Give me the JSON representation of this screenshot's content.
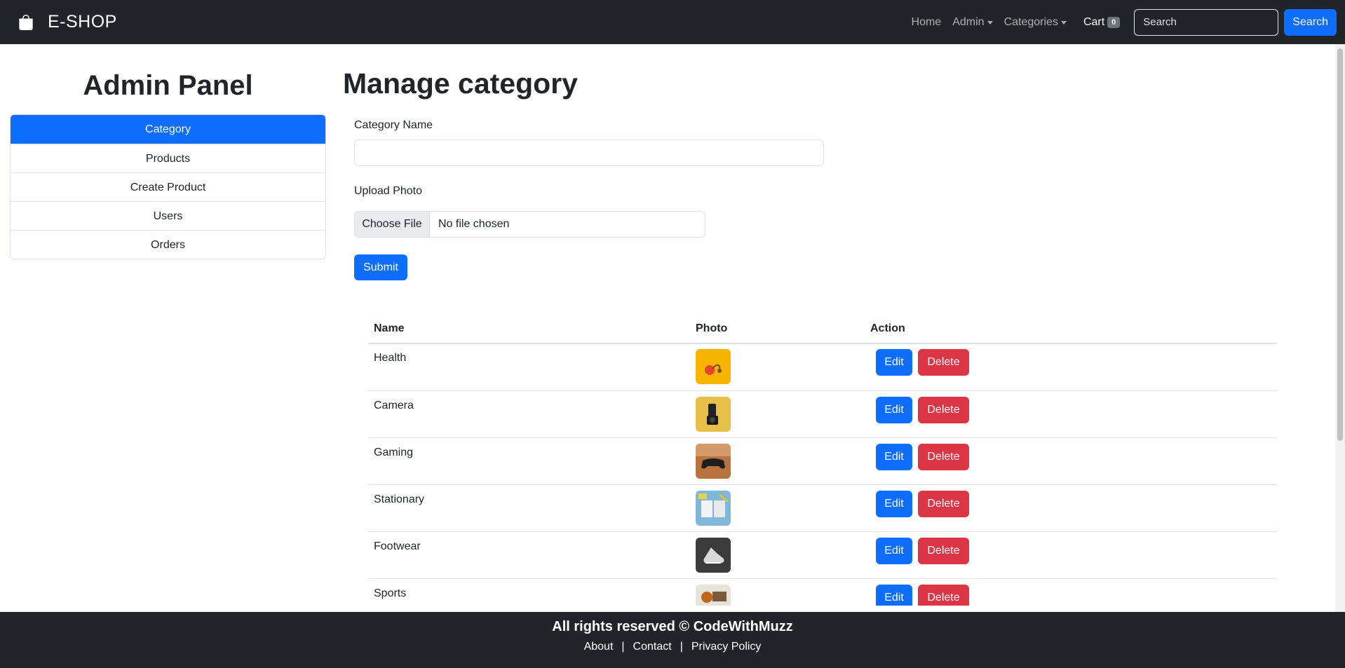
{
  "navbar": {
    "brand": "E-SHOP",
    "links": {
      "home": "Home",
      "admin": "Admin",
      "categories": "Categories"
    },
    "cart_label": "Cart",
    "cart_count": "0",
    "search_placeholder": "Search",
    "search_button": "Search"
  },
  "sidebar": {
    "title": "Admin Panel",
    "items": [
      {
        "label": "Category",
        "active": true
      },
      {
        "label": "Products"
      },
      {
        "label": "Create Product"
      },
      {
        "label": "Users"
      },
      {
        "label": "Orders"
      }
    ]
  },
  "main": {
    "title": "Manage category",
    "form": {
      "name_label": "Category Name",
      "name_value": "",
      "photo_label": "Upload Photo",
      "file_button": "Choose File",
      "file_status": "No file chosen",
      "submit": "Submit"
    },
    "table": {
      "headers": {
        "name": "Name",
        "photo": "Photo",
        "action": "Action"
      },
      "rows": [
        {
          "name": "Health",
          "edit": "Edit",
          "delete": "Delete"
        },
        {
          "name": "Camera",
          "edit": "Edit",
          "delete": "Delete"
        },
        {
          "name": "Gaming",
          "edit": "Edit",
          "delete": "Delete"
        },
        {
          "name": "Stationary",
          "edit": "Edit",
          "delete": "Delete"
        },
        {
          "name": "Footwear",
          "edit": "Edit",
          "delete": "Delete"
        },
        {
          "name": "Sports",
          "edit": "Edit",
          "delete": "Delete"
        }
      ]
    }
  },
  "footer": {
    "text": "All rights reserved © CodeWithMuzz",
    "links": {
      "about": "About",
      "contact": "Contact",
      "privacy": "Privacy Policy"
    },
    "separator": "|"
  },
  "colors": {
    "navbar_bg": "#212529",
    "primary": "#0d6efd",
    "danger": "#dc3545"
  },
  "icons": {
    "brand": "shopping-bag-icon"
  }
}
